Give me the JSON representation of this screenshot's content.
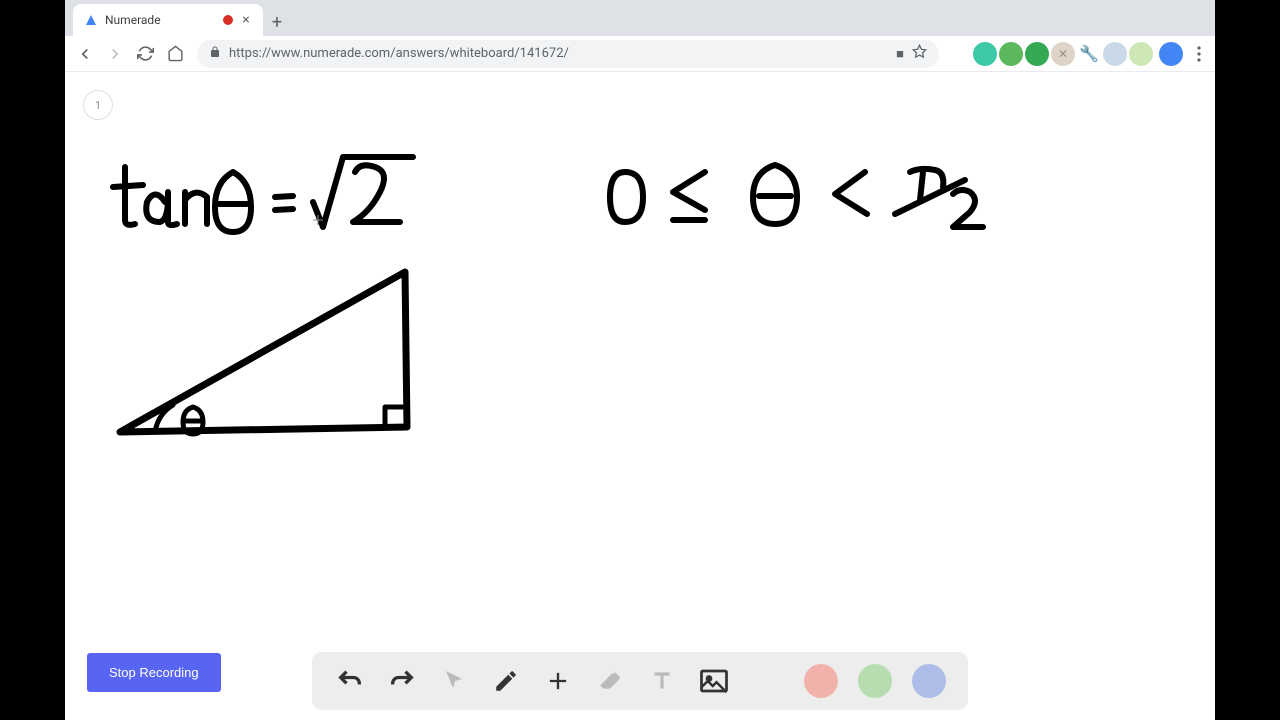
{
  "tab": {
    "title": "Numerade",
    "recording": true
  },
  "browser": {
    "url": "https://www.numerade.com/answers/whiteboard/141672/"
  },
  "page": {
    "badge": "1"
  },
  "whiteboard": {
    "equation1": "tanθ = √2",
    "equation2": "0 ≤ θ < π/2",
    "cursor_glyph": "+"
  },
  "actions": {
    "stop_recording": "Stop Recording"
  },
  "toolbar": {
    "colors": {
      "black": "#000000",
      "red": "#f1b2ab",
      "green": "#b7dcb0",
      "blue": "#aebde8"
    }
  },
  "extension_colors": [
    "#9e9e9e",
    "#3cc9a7",
    "#5cb85c",
    "#34a853",
    "#a08f7a",
    "#f5a623",
    "#8e9fb5",
    "#8bc34a"
  ]
}
